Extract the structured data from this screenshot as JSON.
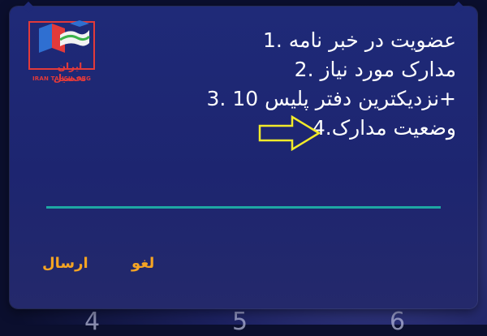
{
  "dialog": {
    "menu_items": [
      "1. عضویت در خبر نامه",
      "2. مدارک مورد نیاز",
      "3. نزدیکترین دفتر پلیس 10+",
      "4.وضعیت مدارک"
    ],
    "send_label": "ارسال",
    "cancel_label": "لغو"
  },
  "logo": {
    "brand_name": "ایران تحصیل",
    "caption": "IRAN TAHSIL.ORG"
  },
  "background": {
    "dial_glyphs": [
      "4",
      "5",
      "6"
    ]
  },
  "colors": {
    "dialog_bg": "#1f2a78",
    "text": "#ffffff",
    "divider": "#1ea7a3",
    "button_text": "#f5a423",
    "arrow": "#f2ea2a",
    "logo_red": "#e23a3a"
  },
  "icons": {
    "pointer_arrow": "arrow-right-outline-icon",
    "logo_mark": "graduation-flag-icon"
  }
}
